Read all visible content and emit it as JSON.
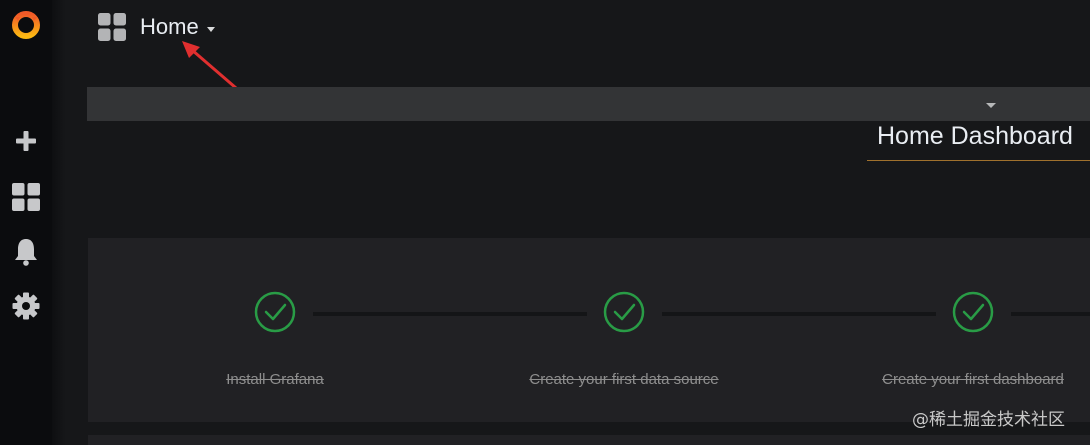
{
  "topbar": {
    "title": "Home"
  },
  "dashboard": {
    "title": "Home Dashboard"
  },
  "steps": [
    {
      "label": "Install Grafana",
      "status": "done"
    },
    {
      "label": "Create your first data source",
      "status": "done"
    },
    {
      "label": "Create your first dashboard",
      "status": "done"
    }
  ],
  "colors": {
    "brand": "#f05a28",
    "check": "#299c46",
    "annotation_arrow": "#e02f2f",
    "title_underline": "#a0712d"
  },
  "icons": {
    "logo": "grafana-logo",
    "sidebar": [
      "plus-icon",
      "dashboards-icon",
      "bell-icon",
      "gear-icon"
    ],
    "topbar": "dashboards-icon"
  },
  "watermark": "@稀土掘金技术社区"
}
